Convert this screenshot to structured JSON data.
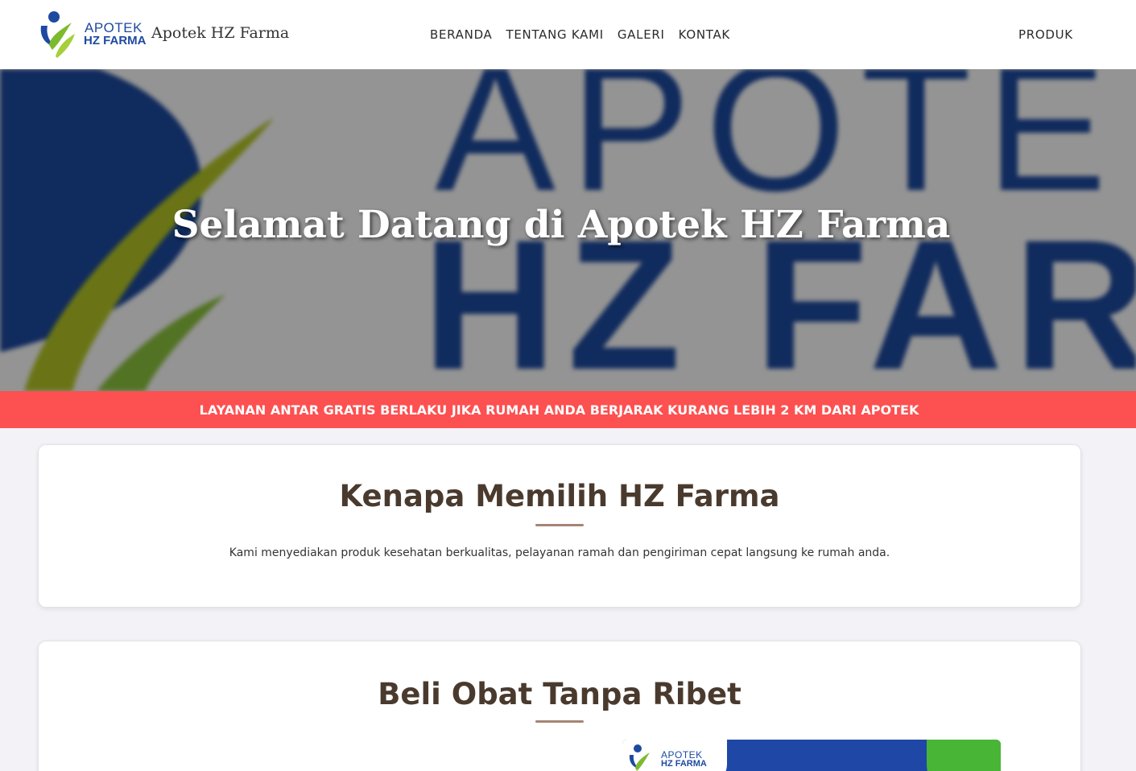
{
  "header": {
    "logo_line1": "APOTEK",
    "logo_line2": "HZ FARMA",
    "brand_name": "Apotek HZ Farma",
    "nav": [
      "BERANDA",
      "TENTANG KAMI",
      "GALERI",
      "KONTAK"
    ],
    "nav_right": "PRODUK"
  },
  "hero": {
    "title": "Selamat Datang di Apotek HZ Farma",
    "bg_text_line1": "APOTE",
    "bg_text_line2": "HZ FARM"
  },
  "promo": {
    "text": "LAYANAN ANTAR GRATIS BERLAKU JIKA RUMAH ANDA BERJARAK KURANG LEBIH 2 KM DARI APOTEK"
  },
  "why": {
    "title": "Kenapa Memilih HZ Farma",
    "text": "Kami menyediakan produk kesehatan berkualitas, pelayanan ramah dan pengiriman cepat langsung ke rumah anda."
  },
  "buy": {
    "title": "Beli Obat Tanpa Ribet",
    "banner_line1": "APOTEK",
    "banner_line2": "HZ FARMA"
  },
  "colors": {
    "promo_bg": "#fd5050",
    "brand_blue": "#1d4aa0",
    "brand_green": "#49b536",
    "heading_brown": "#4a3a2e",
    "divider": "#a68474"
  }
}
